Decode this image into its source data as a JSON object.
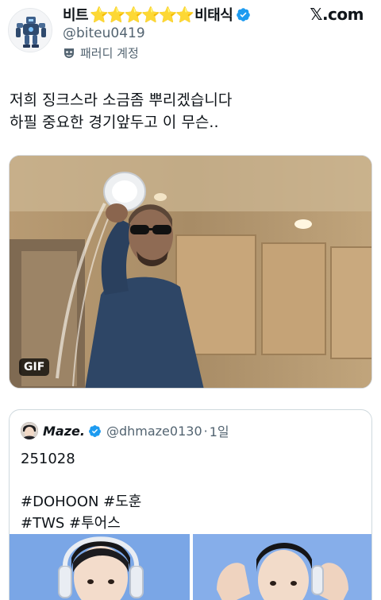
{
  "header": {
    "name_prefix": "비트",
    "name_stars": "⭐⭐⭐⭐⭐⭐",
    "name_suffix": "비태식",
    "handle": "@biteu0419",
    "parody_label": "패러디 계정",
    "brand": "𝕏.com"
  },
  "tweet": {
    "lines": [
      "저희 징크스라 소금좀 뿌리겠습니다",
      "하필 중요한 경기앞두고 이 무슨.."
    ],
    "media_badge": "GIF"
  },
  "quote": {
    "name": "Maze.",
    "handle": "@dhmaze0130",
    "separator": "·",
    "time": "1일",
    "lines": [
      "251028",
      "",
      "#DOHOON #도훈",
      "#TWS #투어스"
    ]
  },
  "colors": {
    "verified": "#1d9bf0",
    "muted": "#536471",
    "star": "#f5b800"
  },
  "icons": {
    "verified": "verified-badge-icon",
    "parody": "mask-icon"
  }
}
